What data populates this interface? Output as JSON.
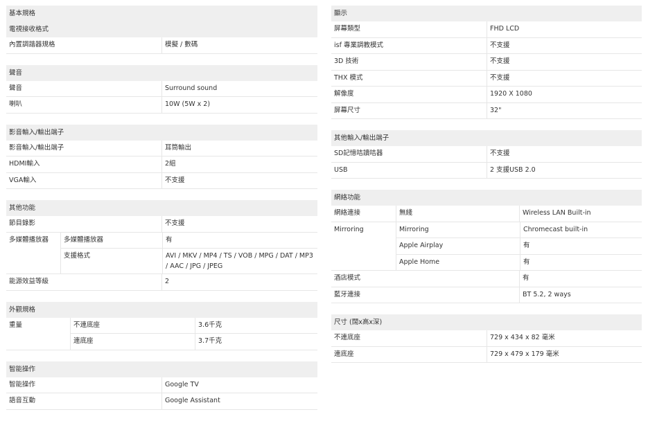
{
  "left": {
    "basic": {
      "title": "基本規格",
      "subtitle": "電視接收格式",
      "rows": [
        {
          "label": "內置調諧器規格",
          "value": "模擬 / 數碼"
        }
      ]
    },
    "sound": {
      "title": "聲音",
      "rows": [
        {
          "label": "聲音",
          "value": "Surround sound"
        },
        {
          "label": "喇叭",
          "value": "10W (5W x 2)"
        }
      ]
    },
    "av": {
      "title": "影音輸入/輸出端子",
      "rows": [
        {
          "label": "影音輸入/輸出端子",
          "value": "耳筒輸出"
        },
        {
          "label": "HDMI輸入",
          "value": "2組"
        },
        {
          "label": "VGA輸入",
          "value": "不支援"
        }
      ]
    },
    "other": {
      "title": "其他功能",
      "record": {
        "label": "節目錄影",
        "value": "不支援"
      },
      "media": {
        "label": "多媒體播放器",
        "rows": [
          {
            "label": "多媒體播放器",
            "value": "有"
          },
          {
            "label": "支援格式",
            "value": "AVI / MKV / MP4 / TS / VOB / MPG / DAT / MP3 / AAC / JPG / JPEG"
          }
        ]
      },
      "energy": {
        "label": "能源效益等級",
        "value": "2"
      }
    },
    "exterior": {
      "title": "外觀規格",
      "weight": {
        "label": "重量",
        "rows": [
          {
            "label": "不連底座",
            "value": "3.6千克"
          },
          {
            "label": "連底座",
            "value": "3.7千克"
          }
        ]
      }
    },
    "smart": {
      "title": "智能操作",
      "rows": [
        {
          "label": "智能操作",
          "value": "Google TV"
        },
        {
          "label": "語音互動",
          "value": "Google Assistant"
        }
      ]
    }
  },
  "right": {
    "display": {
      "title": "顯示",
      "rows": [
        {
          "label": "屏幕類型",
          "value": "FHD LCD"
        },
        {
          "label": "isf 專業調教模式",
          "value": "不支援"
        },
        {
          "label": "3D 技術",
          "value": "不支援"
        },
        {
          "label": "THX 模式",
          "value": "不支援"
        },
        {
          "label": "解像度",
          "value": "1920 X 1080"
        },
        {
          "label": "屏幕尺寸",
          "value": "32\""
        }
      ]
    },
    "otherio": {
      "title": "其他輸入/輸出端子",
      "rows": [
        {
          "label": "SD記憶咭讀咭器",
          "value": "不支援"
        },
        {
          "label": "USB",
          "value": "2 支援USB 2.0"
        }
      ]
    },
    "network": {
      "title": "網絡功能",
      "conn": {
        "label": "網絡連接",
        "sub": "無綫",
        "value": "Wireless LAN Built-in"
      },
      "mirroring": {
        "label": "Mirroring",
        "rows": [
          {
            "label": "Mirroring",
            "value": "Chromecast built-in"
          },
          {
            "label": "Apple Airplay",
            "value": "有"
          },
          {
            "label": "Apple Home",
            "value": "有"
          }
        ]
      },
      "hotel": {
        "label": "酒店模式",
        "value": "有"
      },
      "bt": {
        "label": "藍牙連接",
        "value": "BT 5.2, 2 ways"
      }
    },
    "dims": {
      "title": "尺寸 (闊x高x深)",
      "rows": [
        {
          "label": "不連底座",
          "value": "729 x 434 x 82 毫米"
        },
        {
          "label": "連底座",
          "value": "729 x 479 x 179 毫米"
        }
      ]
    }
  }
}
